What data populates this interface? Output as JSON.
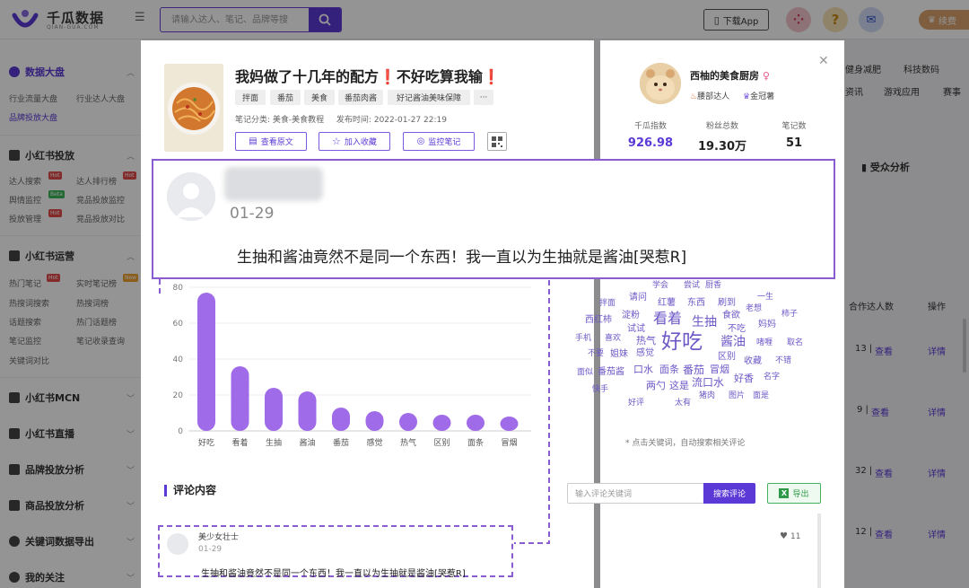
{
  "brand": {
    "name": "千瓜数据",
    "domain": "QIAN-GUA.COM",
    "accent": "#5b39d6"
  },
  "search": {
    "placeholder": "请输入达人、笔记、品牌等搜"
  },
  "header": {
    "app_label": "下载App",
    "vip_label": "续费"
  },
  "sidebar": {
    "sections": [
      {
        "label": "数据大盘",
        "items": [
          "行业流量大盘",
          "行业达人大盘",
          "品牌投放大盘"
        ]
      },
      {
        "label": "小红书投放",
        "items": [
          "达人搜索",
          "达人排行榜",
          "舆情监控",
          "竞品投放监控",
          "投放管理",
          "竞品投放对比"
        ]
      },
      {
        "label": "小红书运营",
        "items": [
          "热门笔记",
          "实时笔记榜",
          "热搜词搜索",
          "热搜词榜",
          "话题搜索",
          "热门话题榜",
          "笔记监控",
          "笔记收录查询",
          "关键词对比"
        ]
      },
      {
        "label": "小红书MCN"
      },
      {
        "label": "小红书直播"
      },
      {
        "label": "品牌投放分析"
      },
      {
        "label": "商品投放分析"
      },
      {
        "label": "关键词数据导出"
      },
      {
        "label": "我的关注"
      }
    ],
    "badges": {
      "hot": "Hot",
      "beta": "Beta",
      "new": "New"
    }
  },
  "background": {
    "categories": [
      "健身减肥",
      "科技数码",
      "资讯",
      "游戏应用",
      "赛事"
    ],
    "audience_tab": "受众分析",
    "table_headers": {
      "creators": "合作达人数",
      "ops": "操作"
    },
    "rows": [
      {
        "count": "13 |",
        "view": "查看",
        "detail": "详情"
      },
      {
        "count": "9 |",
        "view": "查看",
        "detail": "详情"
      },
      {
        "count": "32 |",
        "view": "查看",
        "detail": "详情"
      },
      {
        "count": "12 |",
        "view": "查看",
        "detail": "详情"
      }
    ]
  },
  "note": {
    "title": "我妈做了十几年的配方❗不好吃算我输❗",
    "tags": [
      "拌面",
      "番茄",
      "美食",
      "番茄肉酱",
      "好记酱油美味保障",
      "···"
    ],
    "category_label": "笔记分类:",
    "category": "美食-美食教程",
    "publish_label": "发布时间:",
    "publish_time": "2022-01-27 22:19",
    "buttons": {
      "view_original": "查看原文",
      "favorite": "加入收藏",
      "monitor": "监控笔记"
    }
  },
  "author": {
    "name": "西柚的美食厨房",
    "tags": [
      "腰部达人",
      "金冠薯"
    ],
    "stats": [
      {
        "label": "千瓜指数",
        "value": "926.98"
      },
      {
        "label": "粉丝总数",
        "value": "19.30万"
      },
      {
        "label": "笔记数",
        "value": "51"
      }
    ]
  },
  "highlight_comment": {
    "date": "01-29",
    "text": "生抽和酱油竟然不是同一个东西！我一直以为生抽就是酱油[哭惹R]"
  },
  "chart_data": {
    "type": "bar",
    "categories": [
      "好吃",
      "看着",
      "生抽",
      "酱油",
      "番茄",
      "感觉",
      "热气",
      "区别",
      "面条",
      "冒烟"
    ],
    "values": [
      77,
      36,
      24,
      22,
      13,
      11,
      10,
      9,
      9,
      8
    ],
    "ylim": [
      0,
      80
    ],
    "yticks": [
      0,
      20,
      40,
      60,
      80
    ],
    "bar_color": "#a06be8",
    "grid": true
  },
  "wordcloud": {
    "words": [
      "学会",
      "尝试",
      "厨香",
      "拌面",
      "请问",
      "红薯",
      "东西",
      "刷到",
      "一生",
      "老想",
      "柿子",
      "西红柿",
      "淀粉",
      "看着",
      "生抽",
      "食欲",
      "妈妈",
      "试试",
      "不吃",
      "手机",
      "喜欢",
      "热气",
      "好吃",
      "酱油",
      "啫喱",
      "取名",
      "不要",
      "姐妹",
      "感觉",
      "区别",
      "收藏",
      "不错",
      "面似",
      "番茄酱",
      "口水",
      "面条",
      "番茄",
      "冒烟",
      "好香",
      "名字",
      "快手",
      "两勺",
      "这是",
      "流口水",
      "猪肉",
      "图片",
      "面是",
      "好评",
      "太有"
    ],
    "hint": "* 点击关键词，自动搜索相关评论"
  },
  "comments": {
    "title": "评论内容",
    "search_placeholder": "输入评论关键词",
    "search_button": "搜索评论",
    "export_button": "导出",
    "items": [
      {
        "user": "美少女壮士",
        "date": "01-29",
        "text": "生抽和酱油竟然不是同一个东西！我一直以为生抽就是酱油[哭惹R]",
        "likes": "11"
      }
    ]
  }
}
